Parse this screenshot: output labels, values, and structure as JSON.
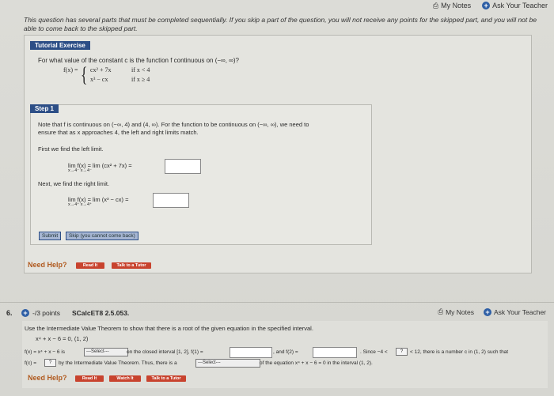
{
  "top_links": {
    "my_notes": "My Notes",
    "ask_teacher": "Ask Your Teacher"
  },
  "warning": "This question has several parts that must be completed sequentially. If you skip a part of the question, you will not receive any points for the skipped part, and you will not be able to come back to the skipped part.",
  "tutorial": {
    "header": "Tutorial Exercise",
    "question": "For what value of the constant c is the function f continuous on (−∞, ∞)?",
    "f_label": "f(x) =",
    "piece1_expr": "cx² + 7x",
    "piece1_cond": "if x < 4",
    "piece2_expr": "x³ − cx",
    "piece2_cond": "if x ≥ 4"
  },
  "step1": {
    "tab": "Step 1",
    "note_line1": "Note that f is continuous on (−∞, 4) and (4, ∞). For the function to be continuous on (−∞, ∞), we need to",
    "note_line2": "ensure that as x approaches 4, the left and right limits match.",
    "first": "First we find the left limit.",
    "left_limit": "lim   f(x) =  lim   (cx² + 7x) =",
    "left_sub": "x→4⁻               x→4⁻",
    "next": "Next, we find the right limit.",
    "right_limit": "lim   f(x) =  lim   (x³ − cx) =",
    "right_sub": "x→4⁺               x→4⁺",
    "submit": "Submit",
    "skip": "Skip (you cannot come back)"
  },
  "help1": {
    "label": "Need Help?",
    "read_it": "Read It",
    "talk_tutor": "Talk to a Tutor"
  },
  "q6": {
    "number": "6.",
    "points": "-/3 points",
    "source": "SCalcET8 2.5.053.",
    "my_notes": "My Notes",
    "ask_teacher": "Ask Your Teacher",
    "instruction": "Use the Intermediate Value Theorem to show that there is a root of the given equation in the specified interval.",
    "equation": "x⁴ + x − 6 = 0,   (1, 2)",
    "line1_a": "f(x) = x⁴ + x − 6 is",
    "select1": "---Select---",
    "line1_b": "on the closed interval [1, 2], f(1) =",
    "line1_c": ", and f(2) =",
    "line1_d": ". Since −4 <",
    "mini1": "?",
    "line1_e": "< 12, there is a number c in (1, 2) such that",
    "line2_a": "f(c) =",
    "mini2": "?",
    "line2_b": "by the Intermediate Value Theorem. Thus, there is a",
    "select2": "---Select---",
    "line2_c": "of the equation x⁴ + x − 6 = 0 in the interval (1, 2)."
  },
  "help2": {
    "label": "Need Help?",
    "read_it": "Read It",
    "watch_it": "Watch It",
    "talk_tutor": "Talk to a Tutor"
  }
}
